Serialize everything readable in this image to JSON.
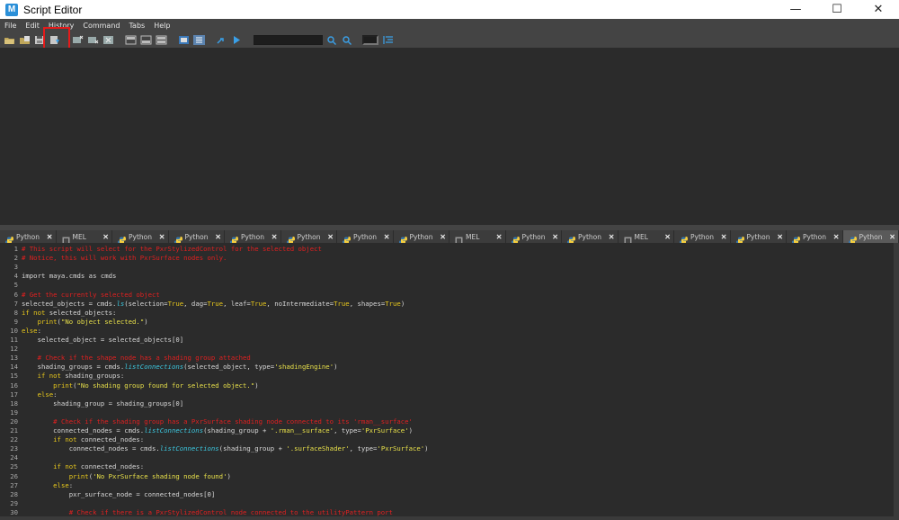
{
  "window": {
    "title": "Script Editor",
    "app_icon": "M",
    "minimize": "—",
    "maximize": "☐",
    "close": "✕"
  },
  "menu": [
    "File",
    "Edit",
    "History",
    "Command",
    "Tabs",
    "Help"
  ],
  "toolbar": {
    "icons": [
      "open-script-icon",
      "load-script-icon",
      "save-script-icon",
      "save-script-to-shelf-icon",
      "clear-history-icon",
      "clear-input-icon",
      "clear-all-icon",
      "show-history-icon",
      "show-input-icon",
      "show-both-icon",
      "echo-all-commands-icon",
      "line-numbers-icon",
      "execute-all-icon",
      "execute-selected-icon"
    ],
    "search_value": "",
    "search_next_icon": "search-next-icon",
    "search_prev_icon": "search-previous-icon",
    "goto_line_value": "",
    "goto_line_icon": "go-to-line-icon",
    "highlight_color": "#e51a1a"
  },
  "tabs": [
    {
      "label": "Python",
      "type": "python",
      "active": false
    },
    {
      "label": "MEL",
      "type": "mel",
      "active": false
    },
    {
      "label": "Python",
      "type": "python",
      "active": false
    },
    {
      "label": "Python",
      "type": "python",
      "active": false
    },
    {
      "label": "Python",
      "type": "python",
      "active": false
    },
    {
      "label": "Python",
      "type": "python",
      "active": false
    },
    {
      "label": "Python",
      "type": "python",
      "active": false
    },
    {
      "label": "Python",
      "type": "python",
      "active": false
    },
    {
      "label": "MEL",
      "type": "mel",
      "active": false
    },
    {
      "label": "Python",
      "type": "python",
      "active": false
    },
    {
      "label": "Python",
      "type": "python",
      "active": false
    },
    {
      "label": "MEL",
      "type": "mel",
      "active": false
    },
    {
      "label": "Python",
      "type": "python",
      "active": false
    },
    {
      "label": "Python",
      "type": "python",
      "active": false
    },
    {
      "label": "Python",
      "type": "python",
      "active": false
    },
    {
      "label": "Python",
      "type": "python",
      "active": true
    }
  ],
  "tab_close": "✕",
  "colors": {
    "comment": "#e02020",
    "keyword": "#e8c81c",
    "string": "#e8e04a",
    "function": "#3cc8e0",
    "background": "#2b2b2b",
    "panel": "#444444"
  },
  "code_lines": [
    [
      {
        "t": "# This script will select for the PxrStylizedControl for the selected object",
        "c": "comment"
      }
    ],
    [
      {
        "t": "# Notice, this will work with PxrSurface nodes only.",
        "c": "comment"
      }
    ],
    [],
    [
      {
        "t": "import maya.cmds as cmds",
        "c": ""
      }
    ],
    [],
    [
      {
        "t": "# Get the currently selected object",
        "c": "comment"
      }
    ],
    [
      {
        "t": "selected_objects = cmds.",
        "c": ""
      },
      {
        "t": "ls",
        "c": "fn"
      },
      {
        "t": "(selection=",
        "c": ""
      },
      {
        "t": "True",
        "c": "true"
      },
      {
        "t": ", dag=",
        "c": ""
      },
      {
        "t": "True",
        "c": "true"
      },
      {
        "t": ", leaf=",
        "c": ""
      },
      {
        "t": "True",
        "c": "true"
      },
      {
        "t": ", noIntermediate=",
        "c": ""
      },
      {
        "t": "True",
        "c": "true"
      },
      {
        "t": ", shapes=",
        "c": ""
      },
      {
        "t": "True",
        "c": "true"
      },
      {
        "t": ")",
        "c": ""
      }
    ],
    [
      {
        "t": "if not",
        "c": "kw"
      },
      {
        "t": " selected_objects:",
        "c": ""
      }
    ],
    [
      {
        "t": "    ",
        "c": ""
      },
      {
        "t": "print",
        "c": "kw"
      },
      {
        "t": "(",
        "c": ""
      },
      {
        "t": "\"No object selected.\"",
        "c": "str"
      },
      {
        "t": ")",
        "c": ""
      }
    ],
    [
      {
        "t": "else",
        "c": "kw"
      },
      {
        "t": ":",
        "c": ""
      }
    ],
    [
      {
        "t": "    selected_object = selected_objects[0]",
        "c": ""
      }
    ],
    [],
    [
      {
        "t": "    ",
        "c": ""
      },
      {
        "t": "# Check if the shape node has a shading group attached",
        "c": "comment"
      }
    ],
    [
      {
        "t": "    shading_groups = cmds.",
        "c": ""
      },
      {
        "t": "listConnections",
        "c": "fn"
      },
      {
        "t": "(selected_object, type=",
        "c": ""
      },
      {
        "t": "'shadingEngine'",
        "c": "str"
      },
      {
        "t": ")",
        "c": ""
      }
    ],
    [
      {
        "t": "    ",
        "c": ""
      },
      {
        "t": "if not",
        "c": "kw"
      },
      {
        "t": " shading_groups:",
        "c": ""
      }
    ],
    [
      {
        "t": "        ",
        "c": ""
      },
      {
        "t": "print",
        "c": "kw"
      },
      {
        "t": "(",
        "c": ""
      },
      {
        "t": "\"No shading group found for selected object.\"",
        "c": "str"
      },
      {
        "t": ")",
        "c": ""
      }
    ],
    [
      {
        "t": "    ",
        "c": ""
      },
      {
        "t": "else",
        "c": "kw"
      },
      {
        "t": ":",
        "c": ""
      }
    ],
    [
      {
        "t": "        shading_group = shading_groups[0]",
        "c": ""
      }
    ],
    [],
    [
      {
        "t": "        ",
        "c": ""
      },
      {
        "t": "# Check if the shading group has a PxrSurface shading node connected to its 'rman__surface'",
        "c": "comment"
      }
    ],
    [
      {
        "t": "        connected_nodes = cmds.",
        "c": ""
      },
      {
        "t": "listConnections",
        "c": "fn"
      },
      {
        "t": "(shading_group + ",
        "c": ""
      },
      {
        "t": "'.rman__surface'",
        "c": "str"
      },
      {
        "t": ", type=",
        "c": ""
      },
      {
        "t": "'PxrSurface'",
        "c": "str"
      },
      {
        "t": ")",
        "c": ""
      }
    ],
    [
      {
        "t": "        ",
        "c": ""
      },
      {
        "t": "if not",
        "c": "kw"
      },
      {
        "t": " connected_nodes:",
        "c": ""
      }
    ],
    [
      {
        "t": "            connected_nodes = cmds.",
        "c": ""
      },
      {
        "t": "listConnections",
        "c": "fn"
      },
      {
        "t": "(shading_group + ",
        "c": ""
      },
      {
        "t": "'.surfaceShader'",
        "c": "str"
      },
      {
        "t": ", type=",
        "c": ""
      },
      {
        "t": "'PxrSurface'",
        "c": "str"
      },
      {
        "t": ")",
        "c": ""
      }
    ],
    [],
    [
      {
        "t": "        ",
        "c": ""
      },
      {
        "t": "if not",
        "c": "kw"
      },
      {
        "t": " connected_nodes:",
        "c": ""
      }
    ],
    [
      {
        "t": "            ",
        "c": ""
      },
      {
        "t": "print",
        "c": "kw"
      },
      {
        "t": "(",
        "c": ""
      },
      {
        "t": "'No PxrSurface shading node found'",
        "c": "str"
      },
      {
        "t": ")",
        "c": ""
      }
    ],
    [
      {
        "t": "        ",
        "c": ""
      },
      {
        "t": "else",
        "c": "kw"
      },
      {
        "t": ":",
        "c": ""
      }
    ],
    [
      {
        "t": "            pxr_surface_node = connected_nodes[0]",
        "c": ""
      }
    ],
    [],
    [
      {
        "t": "            ",
        "c": ""
      },
      {
        "t": "# Check if there is a PxrStylizedControl node connected to the utilityPattern port",
        "c": "comment"
      }
    ]
  ]
}
